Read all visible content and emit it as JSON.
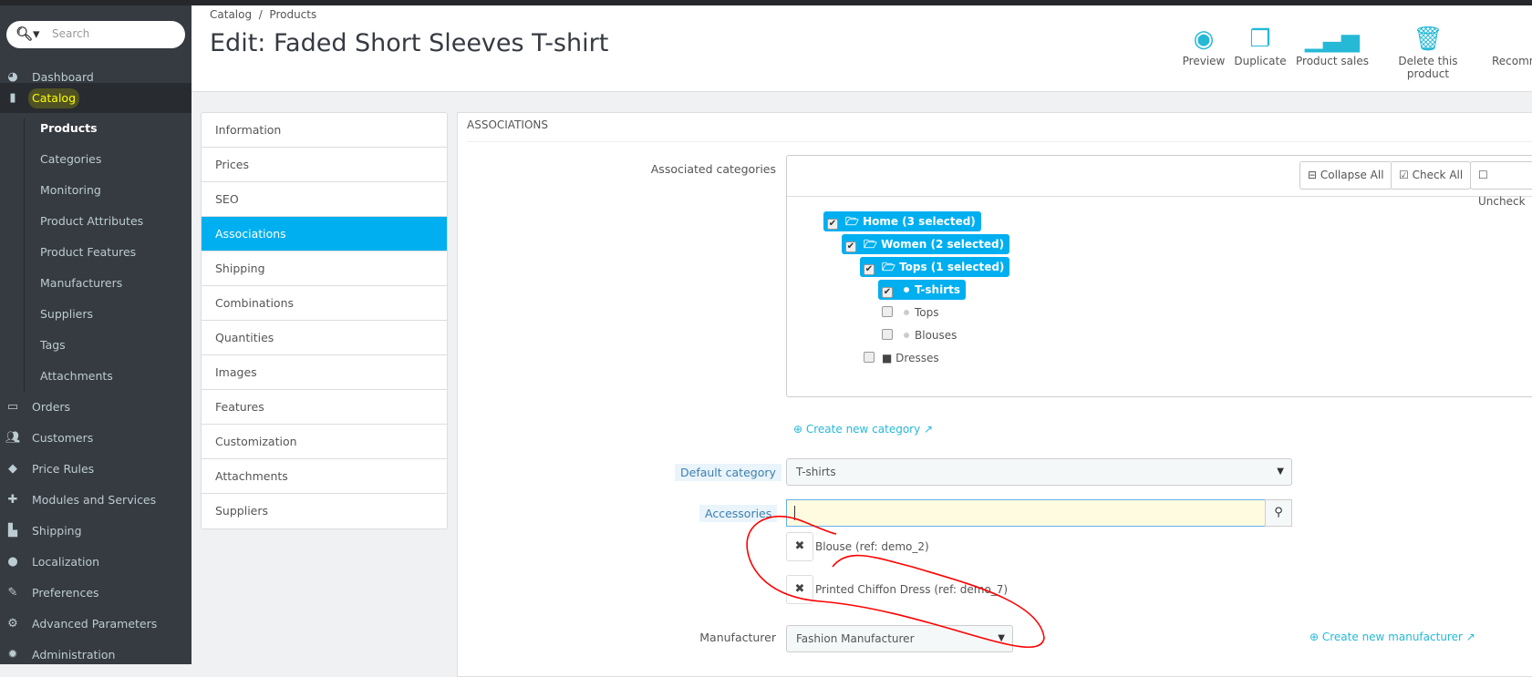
{
  "sidebar": {
    "search_placeholder": "Search",
    "items": [
      {
        "label": "Dashboard",
        "icon": "dashboard-icon"
      },
      {
        "label": "Catalog",
        "icon": "book-icon"
      }
    ],
    "catalog_sub": [
      "Products",
      "Categories",
      "Monitoring",
      "Product Attributes",
      "Product Features",
      "Manufacturers",
      "Suppliers",
      "Tags",
      "Attachments"
    ],
    "more": [
      {
        "label": "Orders",
        "icon": "credit-card-icon"
      },
      {
        "label": "Customers",
        "icon": "users-icon"
      },
      {
        "label": "Price Rules",
        "icon": "tags-icon"
      },
      {
        "label": "Modules and Services",
        "icon": "puzzle-icon"
      },
      {
        "label": "Shipping",
        "icon": "truck-icon"
      },
      {
        "label": "Localization",
        "icon": "globe-icon"
      },
      {
        "label": "Preferences",
        "icon": "wrench-icon"
      },
      {
        "label": "Advanced Parameters",
        "icon": "cogs-icon"
      },
      {
        "label": "Administration",
        "icon": "cog-icon"
      }
    ]
  },
  "header": {
    "breadcrumb": [
      "Catalog",
      "/",
      "Products"
    ],
    "title": "Edit: Faded Short Sleeves T-shirt",
    "toolbar": [
      "Preview",
      "Duplicate",
      "Product sales",
      "Delete this product",
      "Recomm"
    ]
  },
  "tabs": [
    "Information",
    "Prices",
    "SEO",
    "Associations",
    "Shipping",
    "Combinations",
    "Quantities",
    "Images",
    "Features",
    "Customization",
    "Attachments",
    "Suppliers"
  ],
  "panel": {
    "heading": "ASSOCIATIONS",
    "assoc_label": "Associated categories",
    "tree_buttons": [
      "Collapse All",
      "Check All",
      "Uncheck"
    ],
    "tree": [
      "Home (3 selected)",
      "Women (2 selected)",
      "Tops (1 selected)",
      "T-shirts",
      "Tops",
      "Blouses",
      "Dresses"
    ],
    "create_category": "Create new category",
    "default_category_label": "Default category",
    "default_category": "T-shirts",
    "accessories_label": "Accessories",
    "accessories_value": "",
    "accessories": [
      "Blouse (ref: demo_2)",
      "Printed Chiffon Dress (ref: demo_7)"
    ],
    "manufacturer_label": "Manufacturer",
    "manufacturer": "Fashion Manufacturer",
    "create_manufacturer": "Create new manufacturer"
  },
  "colors": {
    "accent": "#00aff0",
    "sidebar": "#363a41",
    "annotation": "#ff0000"
  }
}
